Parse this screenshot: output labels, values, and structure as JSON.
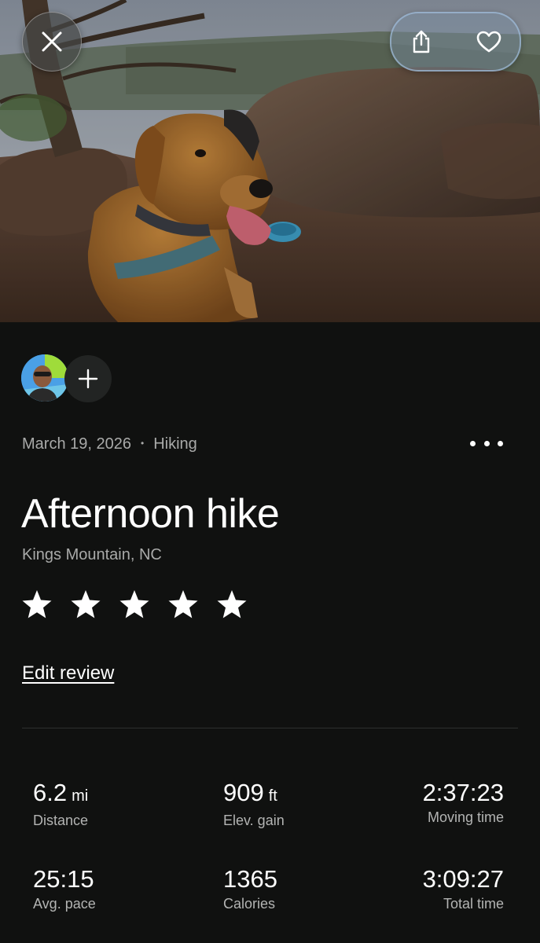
{
  "header": {
    "close_icon": "close-icon",
    "share_icon": "share-icon",
    "favorite_icon": "heart-icon",
    "photo": "hero-photo"
  },
  "participants": {
    "add_icon": "plus-icon"
  },
  "activity": {
    "date": "March 19, 2026",
    "separator": "•",
    "type": "Hiking",
    "title": "Afternoon hike",
    "location": "Kings Mountain, NC",
    "rating": 5,
    "rating_max": 5,
    "edit_review": "Edit review"
  },
  "stats": {
    "distance": {
      "value": "6.2",
      "unit": "mi",
      "label": "Distance"
    },
    "elevation": {
      "value": "909",
      "unit": "ft",
      "label": "Elev. gain"
    },
    "moving_time": {
      "value": "2:37:23",
      "label": "Moving time"
    },
    "avg_pace": {
      "value": "25:15",
      "label": "Avg. pace"
    },
    "calories": {
      "value": "1365",
      "label": "Calories"
    },
    "total_time": {
      "value": "3:09:27",
      "label": "Total time"
    }
  },
  "colors": {
    "background": "#101110",
    "muted_text": "#a9aaa9",
    "text": "#ffffff"
  }
}
